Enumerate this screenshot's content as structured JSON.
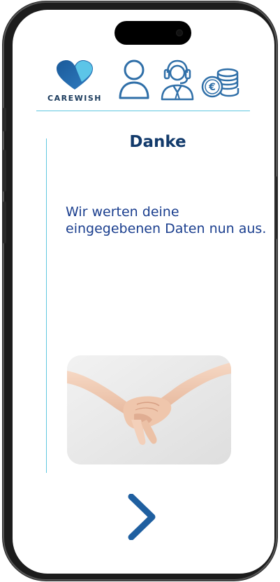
{
  "header": {
    "logo_text": "CAREWISH",
    "nav_icons": [
      "user-icon",
      "support-agent-icon",
      "euro-coins-icon"
    ]
  },
  "main": {
    "title": "Danke",
    "message": "Wir werten deine eingegebenen Daten nun aus.",
    "photo": "holding-hands-photo"
  },
  "footer": {
    "next_icon": "chevron-right-icon"
  },
  "colors": {
    "brand_blue": "#1f5fa0",
    "title_navy": "#123a6b",
    "text_blue": "#1a3e8e",
    "accent_cyan": "#5fc7df",
    "icon_blue": "#2f6fa8"
  }
}
